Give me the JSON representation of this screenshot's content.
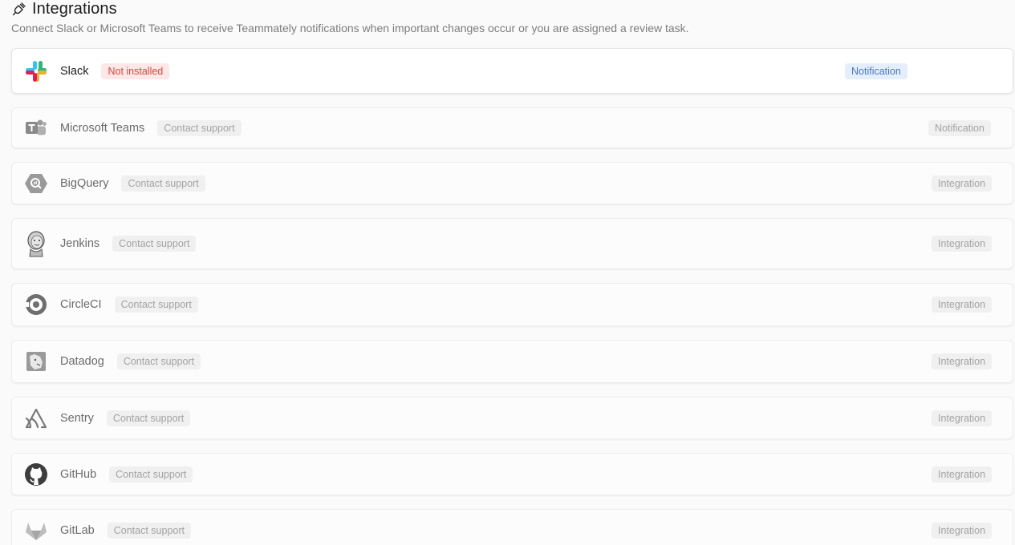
{
  "header": {
    "title": "Integrations",
    "subtitle": "Connect Slack or Microsoft Teams to receive Teammately notifications when important changes occur or you are assigned a review task."
  },
  "integrations": [
    {
      "name": "Slack",
      "status": "Not installed",
      "type": "Notification",
      "icon": "slack-icon"
    },
    {
      "name": "Microsoft Teams",
      "status": "Contact support",
      "type": "Notification",
      "icon": "microsoft-teams-icon"
    },
    {
      "name": "BigQuery",
      "status": "Contact support",
      "type": "Integration",
      "icon": "bigquery-icon"
    },
    {
      "name": "Jenkins",
      "status": "Contact support",
      "type": "Integration",
      "icon": "jenkins-icon"
    },
    {
      "name": "CircleCI",
      "status": "Contact support",
      "type": "Integration",
      "icon": "circleci-icon"
    },
    {
      "name": "Datadog",
      "status": "Contact support",
      "type": "Integration",
      "icon": "datadog-icon"
    },
    {
      "name": "Sentry",
      "status": "Contact support",
      "type": "Integration",
      "icon": "sentry-icon"
    },
    {
      "name": "GitHub",
      "status": "Contact support",
      "type": "Integration",
      "icon": "github-icon"
    },
    {
      "name": "GitLab",
      "status": "Contact support",
      "type": "Integration",
      "icon": "gitlab-icon"
    }
  ],
  "colors": {
    "not_installed_text": "#d9483b",
    "not_installed_bg": "#fde7e7",
    "notification_text": "#4a78c4",
    "notification_bg": "#e5eefb"
  }
}
